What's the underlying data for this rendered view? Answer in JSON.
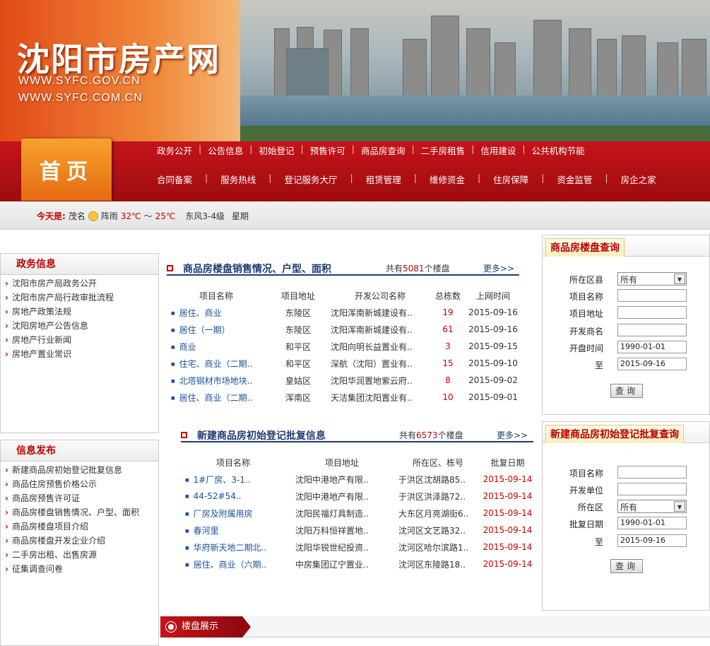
{
  "banner": {
    "title": "沈阳市房产网",
    "url1": "WWW.SYFC.GOV.CN",
    "url2": "WWW.SYFC.COM.CN"
  },
  "nav": {
    "home": "首页",
    "row1": [
      "政务公开",
      "公告信息",
      "初始登记",
      "预售许可",
      "商品房查询",
      "二手房租售",
      "信用建设",
      "公共机构节能"
    ],
    "row2": [
      "合同备案",
      "服务热线",
      "登记服务大厅",
      "租赁管理",
      "维修资金",
      "住房保障",
      "资金监管",
      "房企之家"
    ]
  },
  "weather": {
    "today_label": "今天是:",
    "region": "茂名",
    "icon": "sun-cloud-icon",
    "condition": "阵雨",
    "high": "32℃",
    "range_sep": "～",
    "low": "25℃",
    "wind": "东风3-4级",
    "week": "星期"
  },
  "sidebar": {
    "gov_title": "政务信息",
    "gov_items": [
      "沈阳市房产局政务公开",
      "沈阳市房产局行政审批流程",
      "房地产政策法规",
      "沈阳房地产公告信息",
      "房地产行业新闻",
      "房地产置业常识"
    ],
    "info_title": "信息发布",
    "info_items": [
      "新建商品房初始登记批复信息",
      "商品住房预售价格公示",
      "商品房预售许可证",
      "商品房楼盘销售情况、户型、面积",
      "商品房楼盘项目介绍",
      "商品房楼盘开发企业介绍",
      "二手房出租、出售房源",
      "征集调查问卷"
    ]
  },
  "sales": {
    "title": "商品房楼盘销售情况、户型、面积",
    "count_prefix": "共有",
    "count": "5081",
    "count_suffix": "个楼盘",
    "more": "更多>>",
    "headers": [
      "项目名称",
      "项目地址",
      "开发公司名称",
      "总栋数",
      "上网时间"
    ],
    "rows": [
      [
        "居住、商业",
        "东陵区",
        "沈阳浑南新城建设有..",
        "19",
        "2015-09-16"
      ],
      [
        "居住（一期）",
        "东陵区",
        "沈阳浑南新城建设有..",
        "61",
        "2015-09-16"
      ],
      [
        "商业",
        "和平区",
        "沈阳向明长益置业有..",
        "3",
        "2015-09-15"
      ],
      [
        "住宅、商业（二期..",
        "和平区",
        "深航（沈阳）置业有..",
        "15",
        "2015-09-10"
      ],
      [
        "北塔钢材市场地块..",
        "皇姑区",
        "沈阳华润置地紫云府..",
        "8",
        "2015-09-02"
      ],
      [
        "居住、商业（二期..",
        "浑南区",
        "天洁集团沈阳置业有..",
        "10",
        "2015-09-01"
      ]
    ]
  },
  "register": {
    "title": "新建商品房初始登记批复信息",
    "count_prefix": "共有",
    "count": "6573",
    "count_suffix": "个楼盘",
    "more": "更多>>",
    "headers": [
      "项目名称",
      "项目地址",
      "所在区、栋号",
      "批复日期"
    ],
    "rows": [
      [
        "1#厂房、3-1..",
        "沈阳中港地产有限..",
        "于洪区沈胡路85..",
        "2015-09-14"
      ],
      [
        "44-52#54..",
        "沈阳中港地产有限..",
        "于洪区洪泽路72..",
        "2015-09-14"
      ],
      [
        "厂房及附属用房",
        "沈阳民福灯具制造..",
        "大东区月亮湖街6..",
        "2015-09-14"
      ],
      [
        "春河里",
        "沈阳万科恒祥置地..",
        "沈河区文艺路32..",
        "2015-09-14"
      ],
      [
        "华府新天地二期北..",
        "沈阳华锐世纪投资..",
        "沈河区哈尔滨路1..",
        "2015-09-14"
      ],
      [
        "居住、商业（六期..",
        "中房集团辽宁置业..",
        "沈河区东陵路18..",
        "2015-09-14"
      ]
    ]
  },
  "query1": {
    "title": "商品房楼盘查询",
    "labels": [
      "所在区县",
      "项目名称",
      "项目地址",
      "开发商名",
      "开盘时间",
      "至"
    ],
    "district_value": "所有",
    "date_from": "1990-01-01",
    "date_to": "2015-09-16",
    "button": "查询"
  },
  "query2": {
    "title": "新建商品房初始登记批复查询",
    "labels": [
      "项目名称",
      "开发单位",
      "所在区",
      "批复日期",
      "至"
    ],
    "district_value": "所有",
    "date_from": "1990-01-01",
    "date_to": "2015-09-16",
    "button": "查询"
  },
  "bottom": {
    "tab": "楼盘展示"
  }
}
